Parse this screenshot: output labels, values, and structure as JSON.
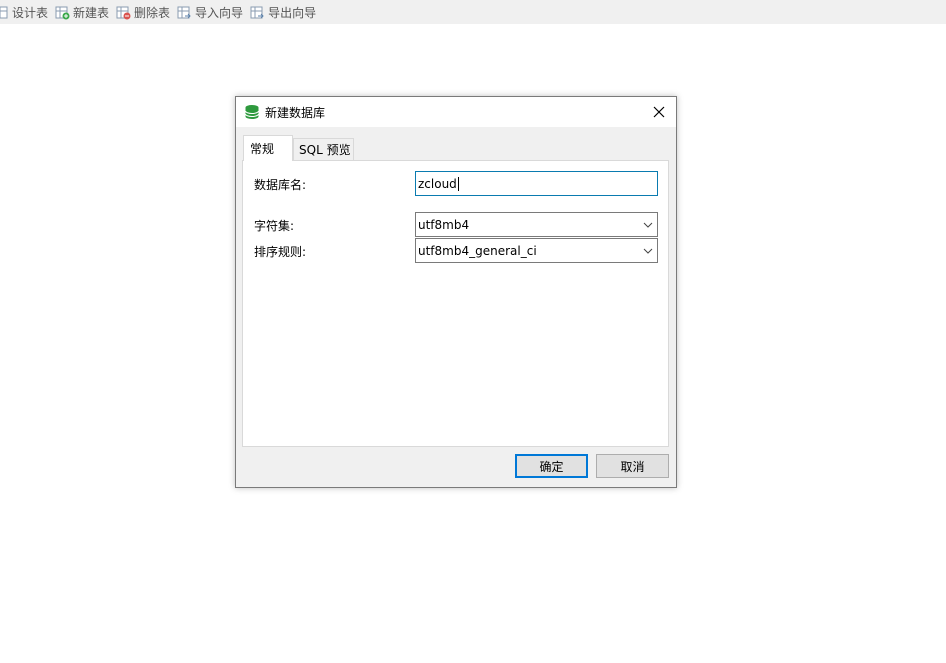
{
  "toolbar": {
    "items": [
      {
        "label": "设计表",
        "icon": "design-table-icon"
      },
      {
        "label": "新建表",
        "icon": "new-table-icon"
      },
      {
        "label": "删除表",
        "icon": "delete-table-icon"
      },
      {
        "label": "导入向导",
        "icon": "import-wizard-icon"
      },
      {
        "label": "导出向导",
        "icon": "export-wizard-icon"
      }
    ]
  },
  "dialog": {
    "title": "新建数据库",
    "icon": "database-icon",
    "tabs": [
      {
        "label": "常规",
        "active": true
      },
      {
        "label": "SQL 预览",
        "active": false
      }
    ],
    "form": {
      "db_name_label": "数据库名:",
      "db_name_value": "zcloud",
      "charset_label": "字符集:",
      "charset_value": "utf8mb4",
      "collation_label": "排序规则:",
      "collation_value": "utf8mb4_general_ci"
    },
    "buttons": {
      "ok": "确定",
      "cancel": "取消"
    }
  },
  "colors": {
    "toolbar_bg": "#f0f0f0",
    "dialog_bg": "#f0f0f0",
    "focus_border": "#0a7bb0",
    "primary_button_border": "#0078d7",
    "db_icon_green": "#2e9a3e"
  }
}
